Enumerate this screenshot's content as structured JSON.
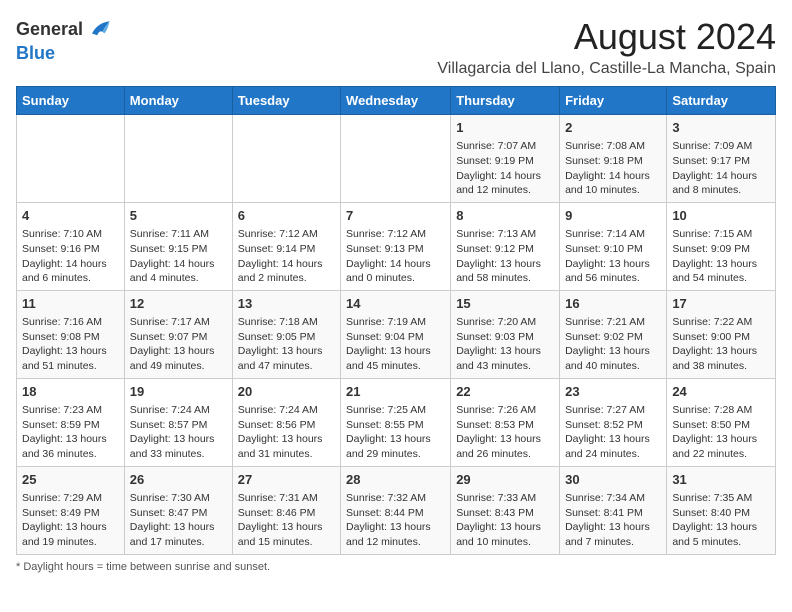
{
  "logo": {
    "text_general": "General",
    "text_blue": "Blue"
  },
  "header": {
    "title": "August 2024",
    "subtitle": "Villagarcia del Llano, Castille-La Mancha, Spain"
  },
  "columns": [
    "Sunday",
    "Monday",
    "Tuesday",
    "Wednesday",
    "Thursday",
    "Friday",
    "Saturday"
  ],
  "footer": {
    "daylight_label": "Daylight hours"
  },
  "weeks": [
    [
      {
        "day": "",
        "info": ""
      },
      {
        "day": "",
        "info": ""
      },
      {
        "day": "",
        "info": ""
      },
      {
        "day": "",
        "info": ""
      },
      {
        "day": "1",
        "info": "Sunrise: 7:07 AM\nSunset: 9:19 PM\nDaylight: 14 hours\nand 12 minutes."
      },
      {
        "day": "2",
        "info": "Sunrise: 7:08 AM\nSunset: 9:18 PM\nDaylight: 14 hours\nand 10 minutes."
      },
      {
        "day": "3",
        "info": "Sunrise: 7:09 AM\nSunset: 9:17 PM\nDaylight: 14 hours\nand 8 minutes."
      }
    ],
    [
      {
        "day": "4",
        "info": "Sunrise: 7:10 AM\nSunset: 9:16 PM\nDaylight: 14 hours\nand 6 minutes."
      },
      {
        "day": "5",
        "info": "Sunrise: 7:11 AM\nSunset: 9:15 PM\nDaylight: 14 hours\nand 4 minutes."
      },
      {
        "day": "6",
        "info": "Sunrise: 7:12 AM\nSunset: 9:14 PM\nDaylight: 14 hours\nand 2 minutes."
      },
      {
        "day": "7",
        "info": "Sunrise: 7:12 AM\nSunset: 9:13 PM\nDaylight: 14 hours\nand 0 minutes."
      },
      {
        "day": "8",
        "info": "Sunrise: 7:13 AM\nSunset: 9:12 PM\nDaylight: 13 hours\nand 58 minutes."
      },
      {
        "day": "9",
        "info": "Sunrise: 7:14 AM\nSunset: 9:10 PM\nDaylight: 13 hours\nand 56 minutes."
      },
      {
        "day": "10",
        "info": "Sunrise: 7:15 AM\nSunset: 9:09 PM\nDaylight: 13 hours\nand 54 minutes."
      }
    ],
    [
      {
        "day": "11",
        "info": "Sunrise: 7:16 AM\nSunset: 9:08 PM\nDaylight: 13 hours\nand 51 minutes."
      },
      {
        "day": "12",
        "info": "Sunrise: 7:17 AM\nSunset: 9:07 PM\nDaylight: 13 hours\nand 49 minutes."
      },
      {
        "day": "13",
        "info": "Sunrise: 7:18 AM\nSunset: 9:05 PM\nDaylight: 13 hours\nand 47 minutes."
      },
      {
        "day": "14",
        "info": "Sunrise: 7:19 AM\nSunset: 9:04 PM\nDaylight: 13 hours\nand 45 minutes."
      },
      {
        "day": "15",
        "info": "Sunrise: 7:20 AM\nSunset: 9:03 PM\nDaylight: 13 hours\nand 43 minutes."
      },
      {
        "day": "16",
        "info": "Sunrise: 7:21 AM\nSunset: 9:02 PM\nDaylight: 13 hours\nand 40 minutes."
      },
      {
        "day": "17",
        "info": "Sunrise: 7:22 AM\nSunset: 9:00 PM\nDaylight: 13 hours\nand 38 minutes."
      }
    ],
    [
      {
        "day": "18",
        "info": "Sunrise: 7:23 AM\nSunset: 8:59 PM\nDaylight: 13 hours\nand 36 minutes."
      },
      {
        "day": "19",
        "info": "Sunrise: 7:24 AM\nSunset: 8:57 PM\nDaylight: 13 hours\nand 33 minutes."
      },
      {
        "day": "20",
        "info": "Sunrise: 7:24 AM\nSunset: 8:56 PM\nDaylight: 13 hours\nand 31 minutes."
      },
      {
        "day": "21",
        "info": "Sunrise: 7:25 AM\nSunset: 8:55 PM\nDaylight: 13 hours\nand 29 minutes."
      },
      {
        "day": "22",
        "info": "Sunrise: 7:26 AM\nSunset: 8:53 PM\nDaylight: 13 hours\nand 26 minutes."
      },
      {
        "day": "23",
        "info": "Sunrise: 7:27 AM\nSunset: 8:52 PM\nDaylight: 13 hours\nand 24 minutes."
      },
      {
        "day": "24",
        "info": "Sunrise: 7:28 AM\nSunset: 8:50 PM\nDaylight: 13 hours\nand 22 minutes."
      }
    ],
    [
      {
        "day": "25",
        "info": "Sunrise: 7:29 AM\nSunset: 8:49 PM\nDaylight: 13 hours\nand 19 minutes."
      },
      {
        "day": "26",
        "info": "Sunrise: 7:30 AM\nSunset: 8:47 PM\nDaylight: 13 hours\nand 17 minutes."
      },
      {
        "day": "27",
        "info": "Sunrise: 7:31 AM\nSunset: 8:46 PM\nDaylight: 13 hours\nand 15 minutes."
      },
      {
        "day": "28",
        "info": "Sunrise: 7:32 AM\nSunset: 8:44 PM\nDaylight: 13 hours\nand 12 minutes."
      },
      {
        "day": "29",
        "info": "Sunrise: 7:33 AM\nSunset: 8:43 PM\nDaylight: 13 hours\nand 10 minutes."
      },
      {
        "day": "30",
        "info": "Sunrise: 7:34 AM\nSunset: 8:41 PM\nDaylight: 13 hours\nand 7 minutes."
      },
      {
        "day": "31",
        "info": "Sunrise: 7:35 AM\nSunset: 8:40 PM\nDaylight: 13 hours\nand 5 minutes."
      }
    ]
  ]
}
